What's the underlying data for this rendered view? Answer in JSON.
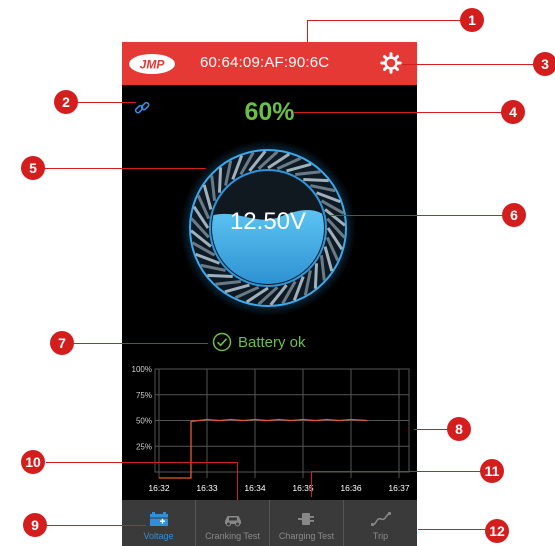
{
  "header": {
    "brand": "JMP",
    "device_address": "60:64:09:AF:90:6C",
    "settings_icon": "gear-icon"
  },
  "connection_icon": "link-icon",
  "charge_percent": "60%",
  "voltage": "12.50V",
  "gauge_fill_fraction": 0.6,
  "status": {
    "icon": "check-circle-icon",
    "text": "Battery ok"
  },
  "chart_data": {
    "type": "line",
    "y_tick_labels": [
      "100%",
      "75%",
      "50%",
      "25%"
    ],
    "x_tick_labels": [
      "16:32",
      "16:33",
      "16:34",
      "16:35",
      "16:36",
      "16:37"
    ],
    "ylim": [
      0,
      100
    ],
    "grid": true,
    "series": [
      {
        "color": "#e8592b",
        "x": [
          "16:32",
          "16:32:40",
          "16:32:40",
          "16:33",
          "16:33:15",
          "16:33:30",
          "16:33:45",
          "16:34",
          "16:34:15",
          "16:34:30",
          "16:34:45",
          "16:35",
          "16:35:15",
          "16:35:30",
          "16:35:45",
          "16:36",
          "16:36:20"
        ],
        "values": [
          0,
          0,
          49,
          51,
          50,
          51,
          50,
          51,
          50,
          51,
          50,
          51,
          50,
          51,
          50,
          51,
          50
        ]
      }
    ]
  },
  "tabs": [
    {
      "label": "Voltage",
      "icon": "battery-icon",
      "active": true
    },
    {
      "label": "Cranking Test",
      "icon": "car-icon",
      "active": false
    },
    {
      "label": "Charging Test",
      "icon": "plug-icon",
      "active": false
    },
    {
      "label": "Trip",
      "icon": "trip-curve-icon",
      "active": false
    }
  ],
  "callouts": [
    "1",
    "2",
    "3",
    "4",
    "5",
    "6",
    "7",
    "8",
    "9",
    "10",
    "11",
    "12"
  ],
  "colors": {
    "header": "#e53935",
    "accent_green": "#6cbf45",
    "accent_blue": "#2f8fd8",
    "callout": "#d41e1e"
  }
}
